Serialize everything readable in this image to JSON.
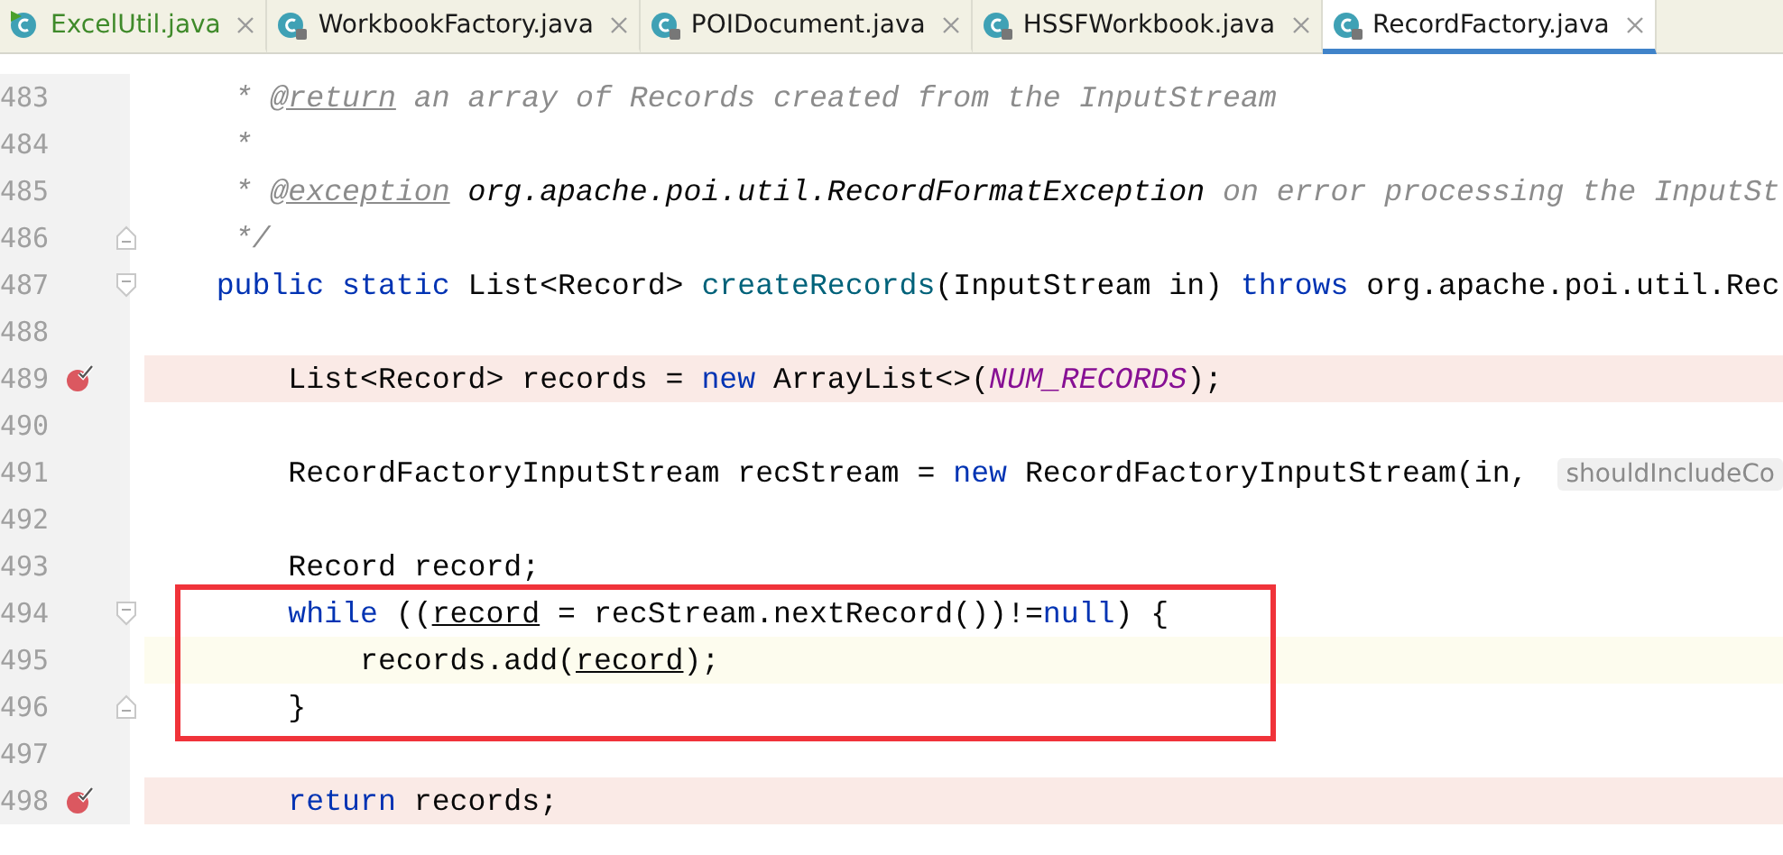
{
  "tabs": [
    {
      "label": "ExcelUtil.java",
      "selected": false,
      "kind": "runnable",
      "vcs_added": true
    },
    {
      "label": "WorkbookFactory.java",
      "selected": false,
      "kind": "class",
      "vcs_added": false
    },
    {
      "label": "POIDocument.java",
      "selected": false,
      "kind": "class",
      "vcs_added": false
    },
    {
      "label": "HSSFWorkbook.java",
      "selected": false,
      "kind": "class",
      "vcs_added": false
    },
    {
      "label": "RecordFactory.java",
      "selected": true,
      "kind": "class",
      "vcs_added": false
    }
  ],
  "lines": [
    {
      "number": "483",
      "breakpoint": false,
      "caret": false,
      "fold_start": false,
      "fold_end": false,
      "tokens": [
        {
          "t": "     * ",
          "kind": "comment"
        },
        {
          "t": "@return",
          "kind": "doctag"
        },
        {
          "t": " an array of Records created from the InputStream",
          "kind": "comment"
        }
      ]
    },
    {
      "number": "484",
      "breakpoint": false,
      "caret": false,
      "fold_start": false,
      "fold_end": false,
      "tokens": [
        {
          "t": "     *",
          "kind": "comment"
        }
      ]
    },
    {
      "number": "485",
      "breakpoint": false,
      "caret": false,
      "fold_start": false,
      "fold_end": false,
      "tokens": [
        {
          "t": "     * ",
          "kind": "comment"
        },
        {
          "t": "@exception",
          "kind": "doctag"
        },
        {
          "t": " org.apache.poi.util.RecordFormatException",
          "kind": "doclink"
        },
        {
          "t": " on error processing the InputSt",
          "kind": "comment"
        }
      ]
    },
    {
      "number": "486",
      "breakpoint": false,
      "caret": false,
      "fold_start": false,
      "fold_end": true,
      "tokens": [
        {
          "t": "     */",
          "kind": "comment"
        }
      ]
    },
    {
      "number": "487",
      "breakpoint": false,
      "caret": false,
      "fold_start": true,
      "fold_end": false,
      "tokens": [
        {
          "t": "    public static",
          "kind": "keyword"
        },
        {
          "t": " List<Record> ",
          "kind": "plain"
        },
        {
          "t": "createRecords",
          "kind": "method"
        },
        {
          "t": "(InputStream in) ",
          "kind": "plain"
        },
        {
          "t": "throws",
          "kind": "keyword"
        },
        {
          "t": " org.apache.poi.util.Rec",
          "kind": "plain"
        }
      ]
    },
    {
      "number": "488",
      "breakpoint": false,
      "caret": false,
      "fold_start": false,
      "fold_end": false
    },
    {
      "number": "489",
      "breakpoint": true,
      "caret": false,
      "fold_start": false,
      "fold_end": false,
      "tokens": [
        {
          "t": "        List<Record> records = ",
          "kind": "plain"
        },
        {
          "t": "new",
          "kind": "keyword"
        },
        {
          "t": " ArrayList<>(",
          "kind": "plain"
        },
        {
          "t": "NUM_RECORDS",
          "kind": "constant"
        },
        {
          "t": ");",
          "kind": "plain"
        }
      ]
    },
    {
      "number": "490",
      "breakpoint": false,
      "caret": false,
      "fold_start": false,
      "fold_end": false
    },
    {
      "number": "491",
      "breakpoint": false,
      "caret": false,
      "fold_start": false,
      "fold_end": false,
      "tokens": [
        {
          "t": "        RecordFactoryInputStream recStream = ",
          "kind": "plain"
        },
        {
          "t": "new",
          "kind": "keyword"
        },
        {
          "t": " RecordFactoryInputStream(in, ",
          "kind": "plain"
        },
        {
          "t": "shouldIncludeCo",
          "kind": "hint"
        }
      ]
    },
    {
      "number": "492",
      "breakpoint": false,
      "caret": false,
      "fold_start": false,
      "fold_end": false
    },
    {
      "number": "493",
      "breakpoint": false,
      "caret": false,
      "fold_start": false,
      "fold_end": false,
      "tokens": [
        {
          "t": "        Record record;",
          "kind": "plain"
        }
      ]
    },
    {
      "number": "494",
      "breakpoint": false,
      "caret": false,
      "fold_start": true,
      "fold_end": false,
      "tokens": [
        {
          "t": "        while",
          "kind": "keyword"
        },
        {
          "t": " ((",
          "kind": "plain"
        },
        {
          "t": "record",
          "kind": "reassigned"
        },
        {
          "t": " = recStream.nextRecord())!=",
          "kind": "plain"
        },
        {
          "t": "null",
          "kind": "keyword"
        },
        {
          "t": ") {",
          "kind": "plain"
        }
      ]
    },
    {
      "number": "495",
      "breakpoint": false,
      "caret": true,
      "fold_start": false,
      "fold_end": false,
      "tokens": [
        {
          "t": "            records.add(",
          "kind": "plain"
        },
        {
          "t": "record",
          "kind": "reassigned"
        },
        {
          "t": ");",
          "kind": "plain"
        }
      ]
    },
    {
      "number": "496",
      "breakpoint": false,
      "caret": false,
      "fold_start": false,
      "fold_end": true,
      "tokens": [
        {
          "t": "        }",
          "kind": "plain"
        }
      ]
    },
    {
      "number": "497",
      "breakpoint": false,
      "caret": false,
      "fold_start": false,
      "fold_end": false
    },
    {
      "number": "498",
      "breakpoint": true,
      "caret": false,
      "fold_start": false,
      "fold_end": false,
      "tokens": [
        {
          "t": "        return",
          "kind": "keyword"
        },
        {
          "t": " records;",
          "kind": "plain"
        }
      ]
    }
  ]
}
